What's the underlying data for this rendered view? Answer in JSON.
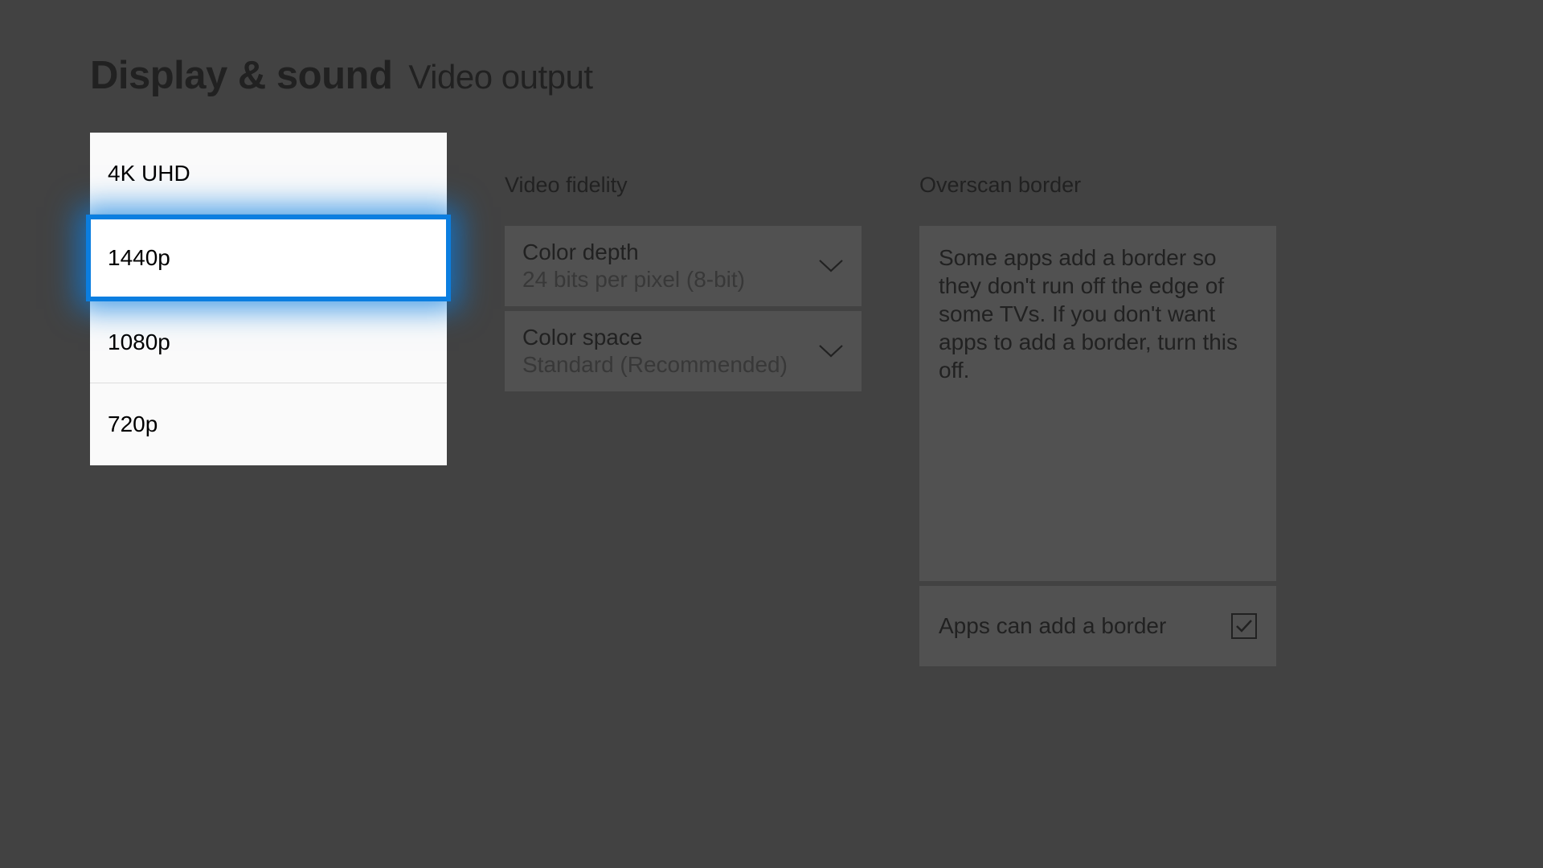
{
  "header": {
    "title": "Display & sound",
    "subtitle": "Video output"
  },
  "resolution_popup": {
    "options": [
      "4K UHD",
      "1440p",
      "1080p",
      "720p"
    ],
    "selected_index": 1
  },
  "video_fidelity": {
    "section_label": "Video fidelity",
    "color_depth": {
      "label": "Color depth",
      "value": "24 bits per pixel (8-bit)"
    },
    "color_space": {
      "label": "Color space",
      "value": "Standard (Recommended)"
    }
  },
  "overscan": {
    "section_label": "Overscan border",
    "description": "Some apps add a border so they don't run off the edge of some TVs. If you don't want apps to add a border, turn this off.",
    "checkbox_label": "Apps can add a border",
    "checked": true
  }
}
